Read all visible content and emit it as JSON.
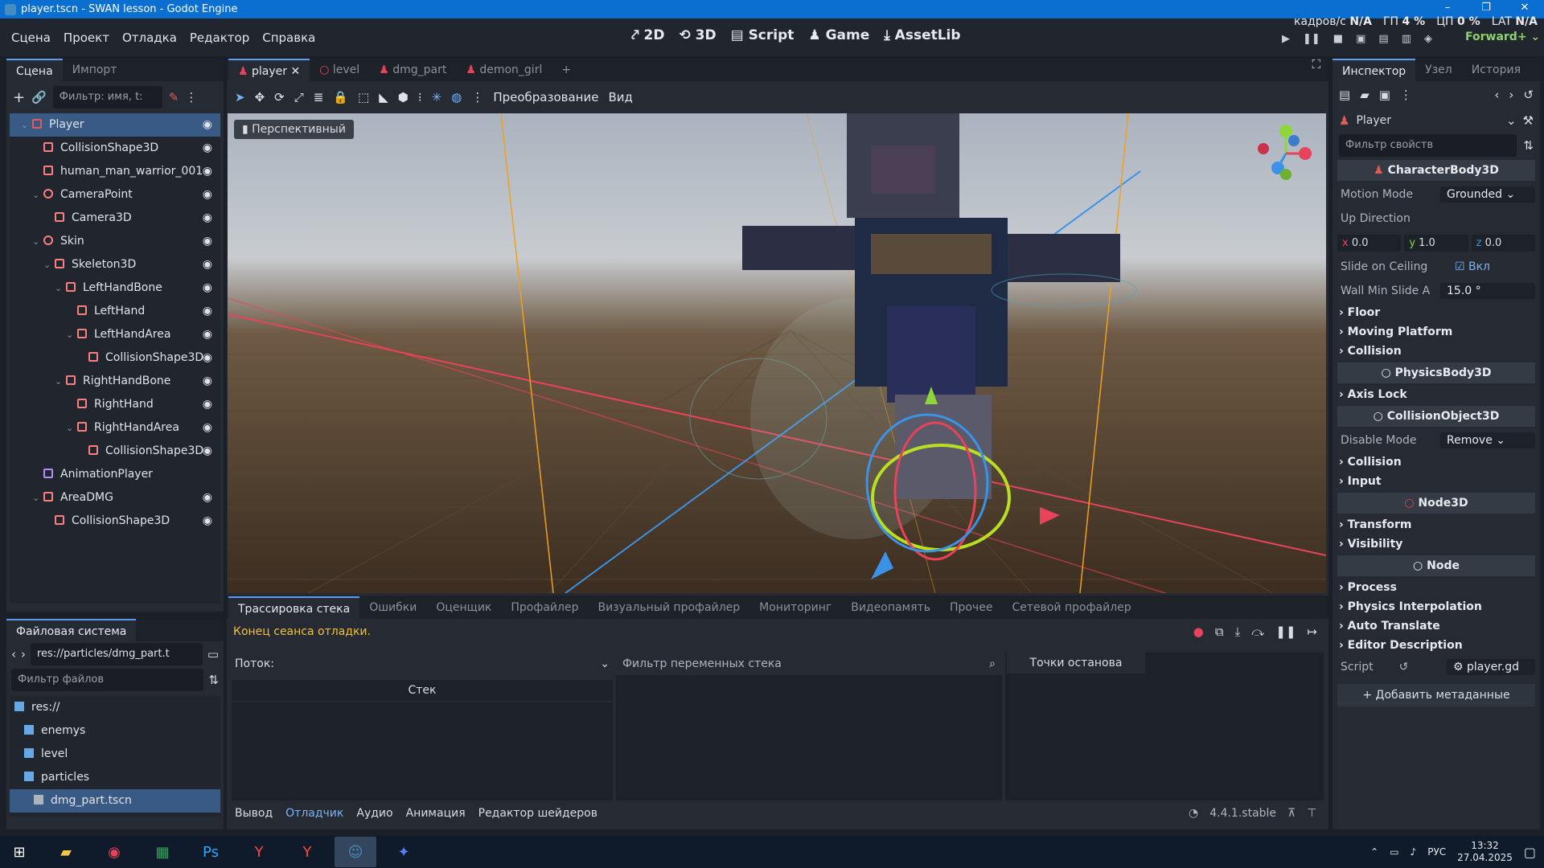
{
  "window": {
    "title": "player.tscn - SWAN lesson - Godot Engine"
  },
  "menu": [
    "Сцена",
    "Проект",
    "Отладка",
    "Редактор",
    "Справка"
  ],
  "workspaces": [
    {
      "label": "2D",
      "icon": "2d-icon"
    },
    {
      "label": "3D",
      "icon": "3d-icon",
      "active": true
    },
    {
      "label": "Script",
      "icon": "script-icon"
    },
    {
      "label": "Game",
      "icon": "game-icon"
    },
    {
      "label": "AssetLib",
      "icon": "assetlib-icon"
    }
  ],
  "perf": {
    "fps_label": "кадров/с",
    "fps": "N/A",
    "gpu_label": "ГП",
    "gpu": "4 %",
    "cpu_label": "ЦП",
    "cpu": "0 %",
    "lat_label": "LAT",
    "lat": "N/A"
  },
  "renderer": "Forward+",
  "scene_panel": {
    "tabs": [
      "Сцена",
      "Импорт"
    ],
    "filter_placeholder": "Фильтр: имя, t:",
    "nodes": [
      {
        "name": "Player",
        "depth": 0,
        "icon": "character-icon",
        "color": "#e25a5a"
      },
      {
        "name": "CollisionShape3D",
        "depth": 1,
        "icon": "collision-shape-icon",
        "color": "#fc7f7f"
      },
      {
        "name": "human_man_warrior_001",
        "depth": 1,
        "icon": "mesh-icon",
        "color": "#fc7f7f"
      },
      {
        "name": "CameraPoint",
        "depth": 1,
        "icon": "node3d-icon",
        "color": "#fc7f7f"
      },
      {
        "name": "Camera3D",
        "depth": 2,
        "icon": "camera-icon",
        "color": "#fc7f7f"
      },
      {
        "name": "Skin",
        "depth": 1,
        "icon": "node3d-icon",
        "color": "#fc7f7f"
      },
      {
        "name": "Skeleton3D",
        "depth": 2,
        "icon": "skeleton-icon",
        "color": "#fc7f7f"
      },
      {
        "name": "LeftHandBone",
        "depth": 3,
        "icon": "bone-icon",
        "color": "#fc7f7f"
      },
      {
        "name": "LeftHand",
        "depth": 4,
        "icon": "marker-icon",
        "color": "#fc7f7f"
      },
      {
        "name": "LeftHandArea",
        "depth": 4,
        "icon": "area-icon",
        "color": "#fc7f7f"
      },
      {
        "name": "CollisionShape3D",
        "depth": 5,
        "icon": "collision-shape-icon",
        "color": "#fc7f7f"
      },
      {
        "name": "RightHandBone",
        "depth": 3,
        "icon": "bone-icon",
        "color": "#fc7f7f"
      },
      {
        "name": "RightHand",
        "depth": 4,
        "icon": "marker-icon",
        "color": "#fc7f7f"
      },
      {
        "name": "RightHandArea",
        "depth": 4,
        "icon": "area-icon",
        "color": "#fc7f7f"
      },
      {
        "name": "CollisionShape3D",
        "depth": 5,
        "icon": "collision-shape-icon",
        "color": "#fc7f7f"
      },
      {
        "name": "AnimationPlayer",
        "depth": 1,
        "icon": "animation-player-icon",
        "color": "#b68cf5"
      },
      {
        "name": "AreaDMG",
        "depth": 1,
        "icon": "area-icon",
        "color": "#fc7f7f"
      },
      {
        "name": "CollisionShape3D",
        "depth": 2,
        "icon": "collision-shape-icon",
        "color": "#fc7f7f"
      }
    ]
  },
  "filesystem": {
    "title": "Файловая система",
    "path": "res://particles/dmg_part.t",
    "filter_placeholder": "Фильтр файлов",
    "items": [
      {
        "name": "res://",
        "depth": 0
      },
      {
        "name": "enemys",
        "depth": 1
      },
      {
        "name": "level",
        "depth": 1
      },
      {
        "name": "particles",
        "depth": 1
      },
      {
        "name": "dmg_part.tscn",
        "depth": 2,
        "selected": true
      }
    ]
  },
  "scene_tabs": [
    "player",
    "level",
    "dmg_part",
    "demon_girl"
  ],
  "viewport": {
    "perspective_label": "Перспективный",
    "transform_menu": "Преобразование",
    "view_menu": "Вид"
  },
  "debugger": {
    "tabs": [
      "Трассировка стека",
      "Ошибки",
      "Оценщик",
      "Профайлер",
      "Визуальный профайлер",
      "Мониторинг",
      "Видеопамять",
      "Прочее",
      "Сетевой профайлер"
    ],
    "status": "Конец сеанса отладки.",
    "thread_label": "Поток:",
    "stack_var_filter": "Фильтр переменных стека",
    "stack_header": "Стек",
    "breakpoints_header": "Точки останова"
  },
  "bottom_tabs": [
    "Вывод",
    "Отладчик",
    "Аудио",
    "Анимация",
    "Редактор шейдеров"
  ],
  "version": "4.4.1.stable",
  "inspector": {
    "tabs": [
      "Инспектор",
      "Узел",
      "История"
    ],
    "node_name": "Player",
    "filter_placeholder": "Фильтр свойств",
    "class1": "CharacterBody3D",
    "motion_mode_label": "Motion Mode",
    "motion_mode": "Grounded",
    "up_dir_label": "Up Direction",
    "up_x": "0.0",
    "up_y": "1.0",
    "up_z": "0.0",
    "slide_ceiling_label": "Slide on Ceiling",
    "slide_ceiling": "Вкл",
    "wall_min_label": "Wall Min Slide A",
    "wall_min": "15.0 °",
    "sec_floor": "Floor",
    "sec_moving": "Moving Platform",
    "sec_collision1": "Collision",
    "class2": "PhysicsBody3D",
    "sec_axislock": "Axis Lock",
    "class3": "CollisionObject3D",
    "disable_mode_label": "Disable Mode",
    "disable_mode": "Remove",
    "sec_collision2": "Collision",
    "sec_input": "Input",
    "class4": "Node3D",
    "sec_transform": "Transform",
    "sec_visibility": "Visibility",
    "class5": "Node",
    "sec_process": "Process",
    "sec_physinterp": "Physics Interpolation",
    "sec_autotrans": "Auto Translate",
    "sec_editordesc": "Editor Description",
    "script_label": "Script",
    "script_value": "player.gd",
    "add_meta": "Добавить метаданные"
  },
  "taskbar": {
    "lang": "РУС",
    "time": "13:32",
    "date": "27.04.2025"
  }
}
